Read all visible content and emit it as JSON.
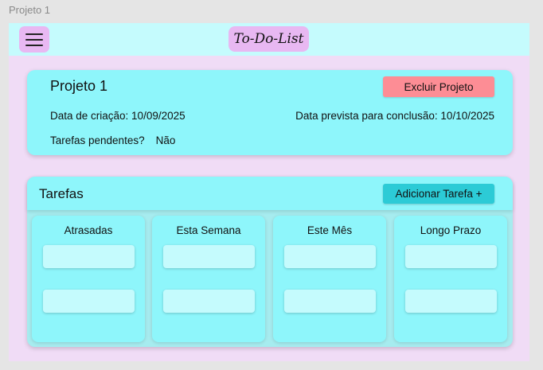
{
  "frame_label": "Projeto 1",
  "header": {
    "app_title": "To-Do-List",
    "menu_icon": "hamburger-menu-icon"
  },
  "project": {
    "title": "Projeto 1",
    "delete_label": "Excluir Projeto",
    "created_label": "Data de criação: 10/09/2025",
    "due_label": "Data prevista para conclusão: 10/10/2025",
    "pending_label": "Tarefas pendentes?",
    "pending_value": "Não"
  },
  "tasks": {
    "title": "Tarefas",
    "add_label": "Adicionar Tarefa +",
    "columns": [
      {
        "title": "Atrasadas"
      },
      {
        "title": "Esta Semana"
      },
      {
        "title": "Este Mês"
      },
      {
        "title": "Longo Prazo"
      }
    ]
  },
  "colors": {
    "background": "#f0dcf6",
    "topbar": "#c5fbfd",
    "accent_pink": "#e8b8f2",
    "card": "#8ef6fb",
    "delete": "#fd8d95",
    "add": "#2ccbd6"
  }
}
